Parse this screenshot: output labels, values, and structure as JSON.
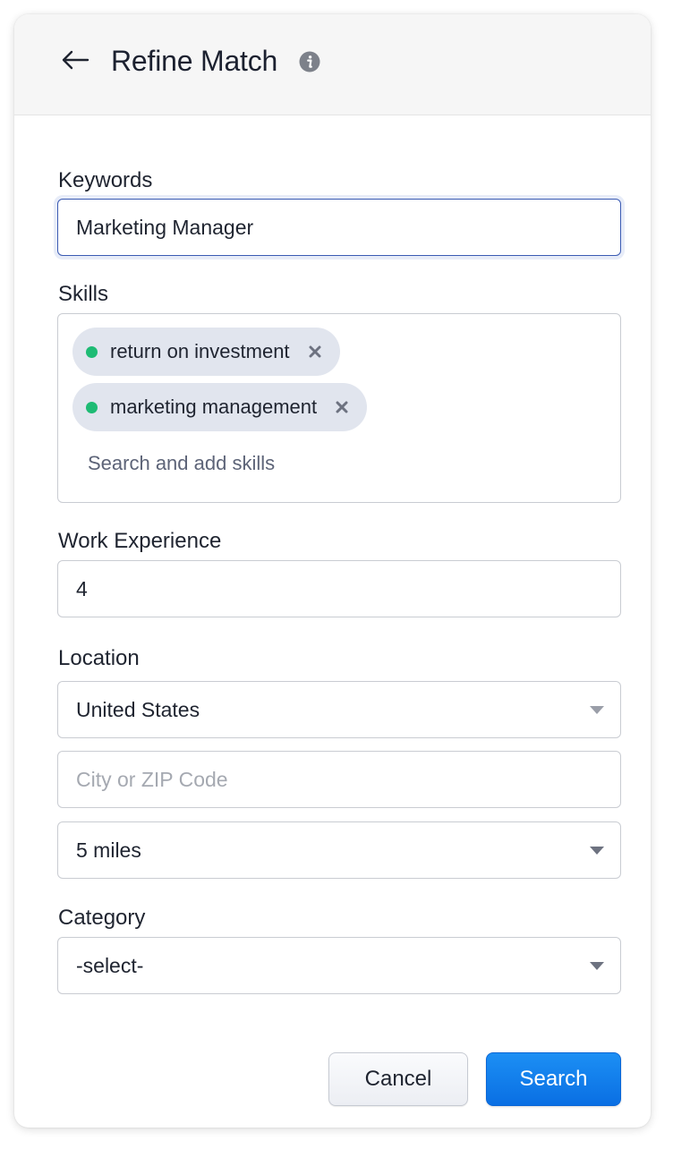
{
  "header": {
    "title": "Refine Match"
  },
  "keywords": {
    "label": "Keywords",
    "value": "Marketing Manager"
  },
  "skills": {
    "label": "Skills",
    "chips": [
      {
        "label": "return on investment"
      },
      {
        "label": "marketing management"
      }
    ],
    "placeholder": "Search and add skills"
  },
  "experience": {
    "label": "Work Experience",
    "value": "4"
  },
  "location": {
    "label": "Location",
    "country": "United States",
    "city_placeholder": "City or ZIP Code",
    "radius": "5 miles"
  },
  "category": {
    "label": "Category",
    "value": "-select-"
  },
  "buttons": {
    "cancel": "Cancel",
    "search": "Search"
  },
  "colors": {
    "primary": "#0a6fe3",
    "chip_bg": "#e1e5ee",
    "chip_dot": "#1ebb74",
    "header_bg": "#f6f6f6"
  }
}
